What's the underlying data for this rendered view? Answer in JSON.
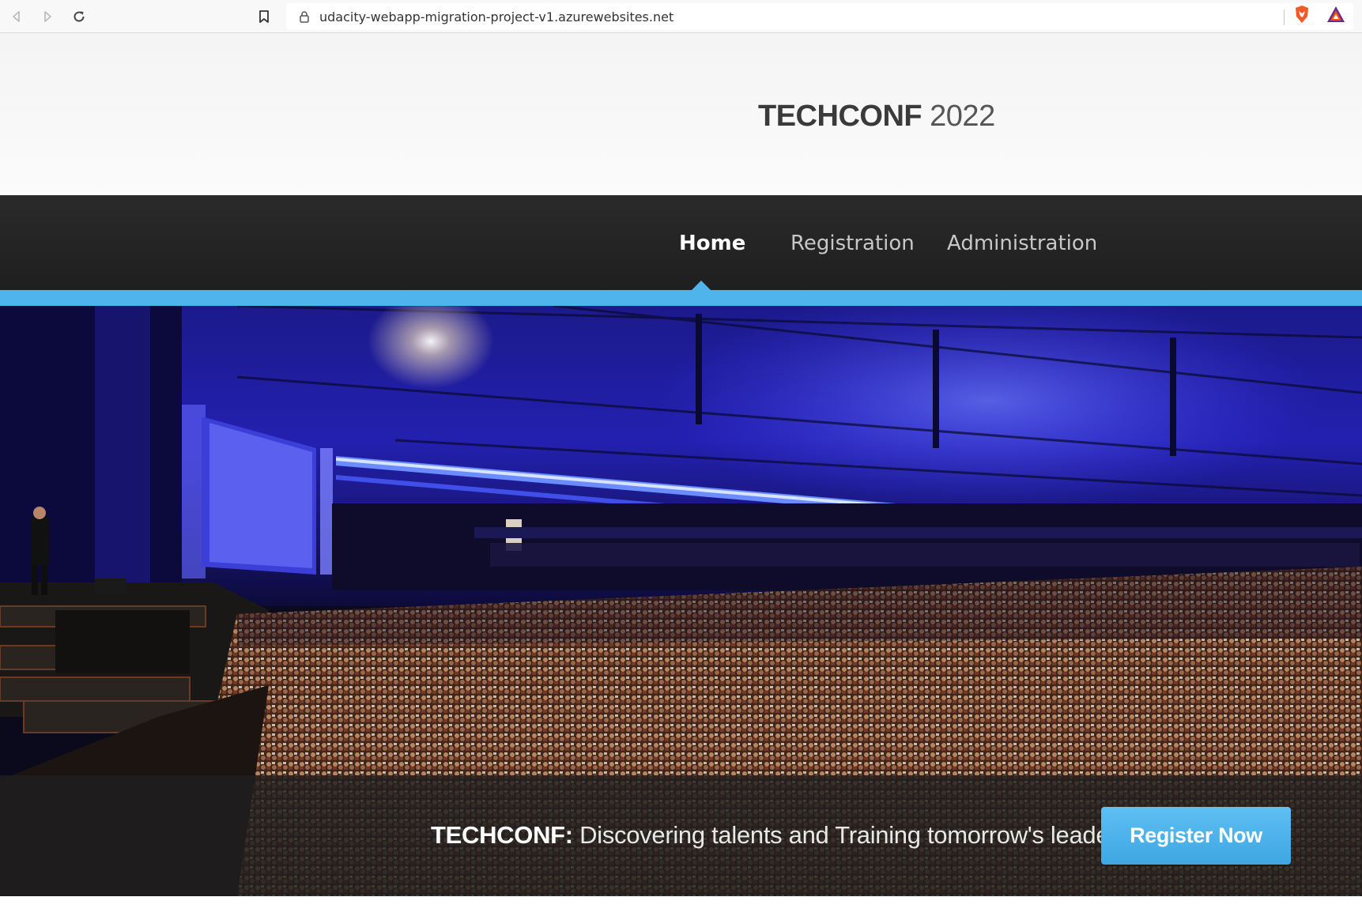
{
  "browser": {
    "url": "udacity-webapp-migration-project-v1.azurewebsites.net",
    "icons": [
      "back-icon",
      "forward-icon",
      "reload-icon",
      "bookmark-icon",
      "lock-icon",
      "brave-shield-icon",
      "brave-rewards-icon"
    ]
  },
  "header": {
    "brand": "TECHCONF",
    "year": " 2022"
  },
  "nav": {
    "items": [
      {
        "label": "Home",
        "active": true
      },
      {
        "label": "Registration",
        "active": false
      },
      {
        "label": "Administration",
        "active": false
      }
    ]
  },
  "hero": {
    "tagline_brand": "TECHCONF:",
    "tagline_text": " Discovering talents and Training tomorrow's leaders",
    "cta_label": "Register Now"
  },
  "colors": {
    "accent": "#4fb3ec",
    "nav_bg": "#252525",
    "button": "#4aafe8"
  }
}
